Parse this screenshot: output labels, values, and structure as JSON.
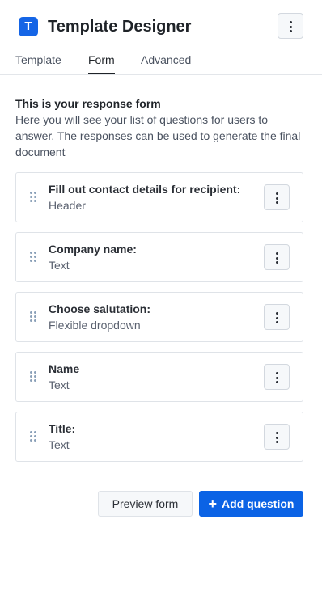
{
  "app": {
    "logo_letter": "T",
    "title": "Template Designer"
  },
  "tabs": [
    {
      "label": "Template",
      "active": false
    },
    {
      "label": "Form",
      "active": true
    },
    {
      "label": "Advanced",
      "active": false
    }
  ],
  "intro": {
    "heading": "This is your response form",
    "description": "Here you will see your list of questions for users to answer. The responses can be used to generate the final document"
  },
  "questions": [
    {
      "title": "Fill out contact details for recipient:",
      "type": "Header"
    },
    {
      "title": "Company name:",
      "type": "Text"
    },
    {
      "title": "Choose salutation:",
      "type": "Flexible dropdown"
    },
    {
      "title": "Name",
      "type": "Text"
    },
    {
      "title": "Title:",
      "type": "Text"
    }
  ],
  "actions": {
    "preview_label": "Preview form",
    "add_label": "Add question"
  },
  "colors": {
    "brand": "#1565e6",
    "primary_button": "#0b63e5"
  },
  "icons": {
    "header_menu": "kebab-icon",
    "drag": "drag-handle-icon",
    "add": "plus-icon"
  }
}
